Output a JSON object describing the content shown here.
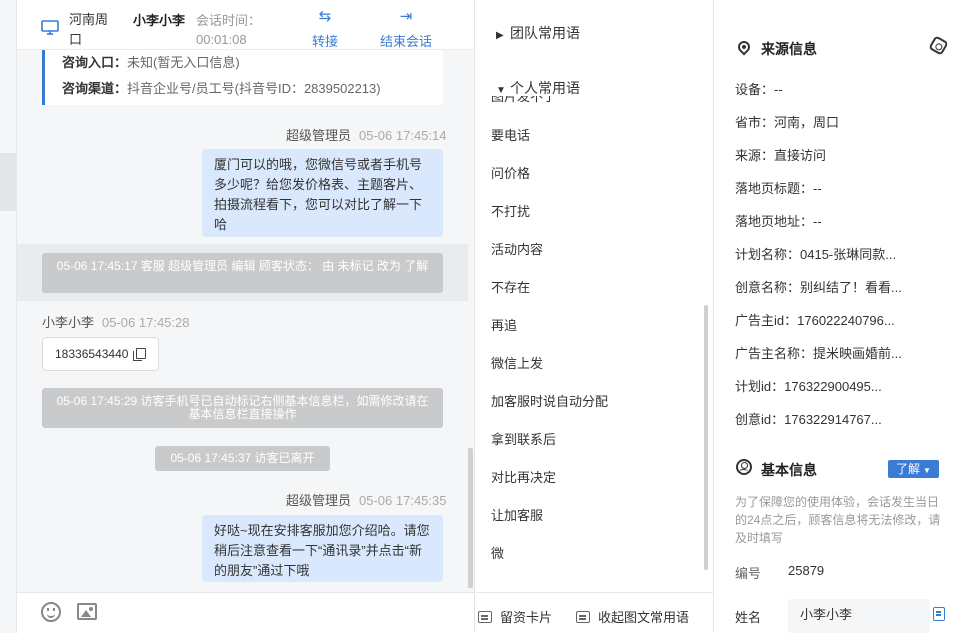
{
  "header": {
    "location": "河南周口",
    "visitor_name": "小李小李",
    "session_time_label": "会话时间：",
    "session_time_value": "00:01:08",
    "transfer_label": "转接",
    "end_label": "结束会话"
  },
  "inquiry": {
    "entry_label": "咨询入口：",
    "entry_value": "未知(暂无入口信息)",
    "channel_label": "咨询渠道：",
    "channel_value": "抖音企业号/员工号(抖音号ID：2839502213)"
  },
  "messages": [
    {
      "sender": "超级管理员",
      "time": "05-06 17:45:14",
      "text": "厦门可以的哦，您微信号或者手机号多少呢？给您发价格表、主题客片、拍摄流程看下，您可以对比了解一下哈"
    },
    {
      "system": "05-06 17:45:17 客服 超级管理员 编辑 顾客状态： 由 未标记 改为 了解"
    },
    {
      "sender": "小李小李",
      "time": "05-06 17:45:28",
      "text": "18336543440"
    },
    {
      "system": "05-06 17:45:29 访客手机号已自动标记右侧基本信息栏，如需修改请在基本信息栏直接操作"
    },
    {
      "system": "05-06 17:45:37 访客已离开"
    },
    {
      "sender": "超级管理员",
      "time": "05-06 17:45:35",
      "text": "好哒~现在安排客服加您介绍哈。请您稍后注意查看一下“通讯录”并点击“新的朋友”通过下哦"
    }
  ],
  "footer": {
    "emoji_icon": "smiley-icon",
    "image_icon": "image-icon"
  },
  "phrases": {
    "team_group": "团队常用语",
    "personal_group": "个人常用语",
    "partial_item": "图片发不了",
    "items": [
      "要电话",
      "问价格",
      "不打扰",
      "活动内容",
      "不存在",
      "再追",
      "微信上发",
      "加客服时说自动分配",
      "拿到联系后",
      "对比再决定",
      "让加客服",
      "微"
    ],
    "leave_card_label": "留资卡片",
    "collapse_label": "收起图文常用语"
  },
  "source_info": {
    "title": "来源信息",
    "fields": [
      {
        "label": "设备：",
        "value": "--"
      },
      {
        "label": "省市：",
        "value": "河南，周口"
      },
      {
        "label": "来源：",
        "value": "直接访问"
      },
      {
        "label": "落地页标题：",
        "value": "--"
      },
      {
        "label": "落地页地址：",
        "value": "--"
      },
      {
        "label": "计划名称：",
        "value": "0415-张琳同款..."
      },
      {
        "label": "创意名称：",
        "value": "别纠结了！看看..."
      },
      {
        "label": "广告主id：",
        "value": "176022240796..."
      },
      {
        "label": "广告主名称：",
        "value": "提米映画婚前..."
      },
      {
        "label": "计划id：",
        "value": "176322900495..."
      },
      {
        "label": "创意id：",
        "value": "176322914767..."
      }
    ]
  },
  "basic_info": {
    "title": "基本信息",
    "status": "了解",
    "note": "为了保障您的使用体验，会话发生当日的24点之后，顾客信息将无法修改，请及时填写",
    "number_label": "编号",
    "number_value": "25879",
    "name_label": "姓名",
    "name_value": "小李小李"
  },
  "colors": {
    "accent": "#3a7bd5",
    "bubble": "#d9e8fc",
    "system_bubble": "#c9cacc"
  }
}
